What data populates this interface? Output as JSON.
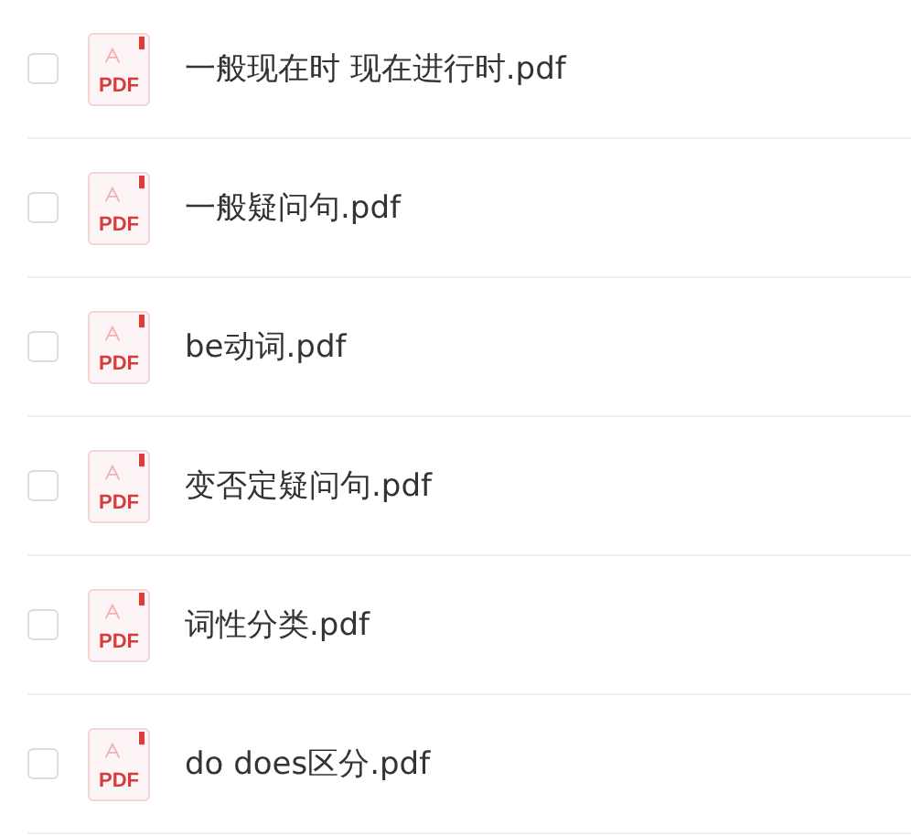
{
  "files": [
    {
      "name": "一般现在时 现在进行时.pdf",
      "badge": "PDF",
      "checked": false
    },
    {
      "name": "一般疑问句.pdf",
      "badge": "PDF",
      "checked": false
    },
    {
      "name": "be动词.pdf",
      "badge": "PDF",
      "checked": false
    },
    {
      "name": "变否定疑问句.pdf",
      "badge": "PDF",
      "checked": false
    },
    {
      "name": "词性分类.pdf",
      "badge": "PDF",
      "checked": false
    },
    {
      "name": "do does区分.pdf",
      "badge": "PDF",
      "checked": false
    }
  ]
}
